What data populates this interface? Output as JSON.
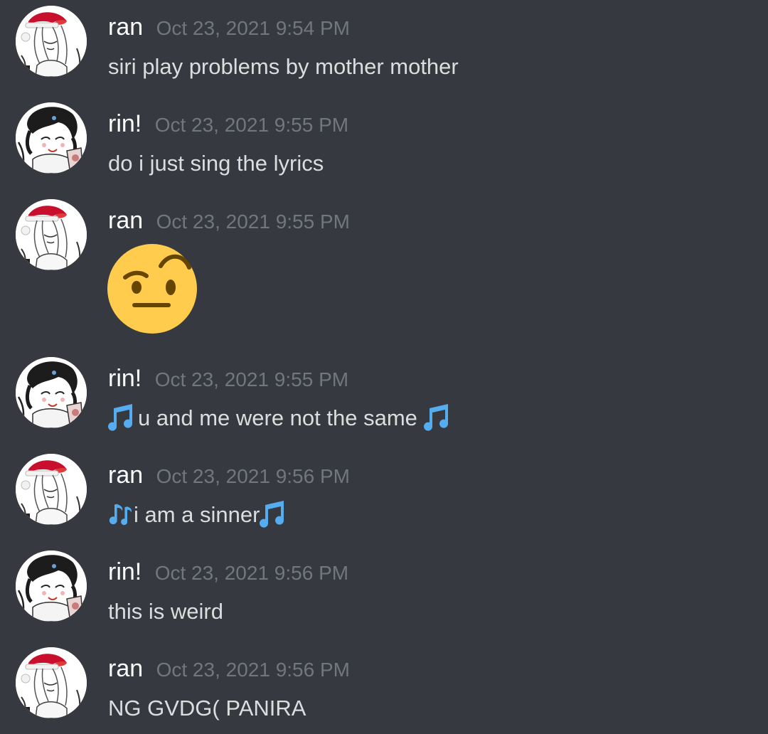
{
  "messages": [
    {
      "author": "ran",
      "timestamp": "Oct 23, 2021 9:54 PM",
      "text": "siri play problems by mother mother",
      "avatar": "ran-avatar"
    },
    {
      "author": "rin!",
      "timestamp": "Oct 23, 2021 9:55 PM",
      "text": "do i just sing the lyrics",
      "avatar": "rin-avatar"
    },
    {
      "author": "ran",
      "timestamp": "Oct 23, 2021 9:55 PM",
      "emoji": "face-with-raised-eyebrow",
      "avatar": "ran-avatar"
    },
    {
      "author": "rin!",
      "timestamp": "Oct 23, 2021 9:55 PM",
      "text": "u and me were not the same ",
      "avatar": "rin-avatar",
      "prefix_icon": "musical-notes-icon",
      "suffix_icon": "musical-notes-icon"
    },
    {
      "author": "ran",
      "timestamp": "Oct 23, 2021 9:56 PM",
      "text": "i am a sinner",
      "avatar": "ran-avatar",
      "prefix_icon": "musical-note-icon",
      "suffix_icon": "musical-notes-icon"
    },
    {
      "author": "rin!",
      "timestamp": "Oct 23, 2021 9:56 PM",
      "text": "this is weird",
      "avatar": "rin-avatar"
    },
    {
      "author": "ran",
      "timestamp": "Oct 23, 2021 9:56 PM",
      "text": "NG GVDG( PANIRA",
      "avatar": "ran-avatar"
    }
  ],
  "colors": {
    "background": "#36393f",
    "author": "#ffffff",
    "timestamp": "#72767d",
    "text": "#dcddde",
    "note": "#55acee",
    "emoji_face": "#ffcc4d",
    "emoji_features": "#664500"
  }
}
